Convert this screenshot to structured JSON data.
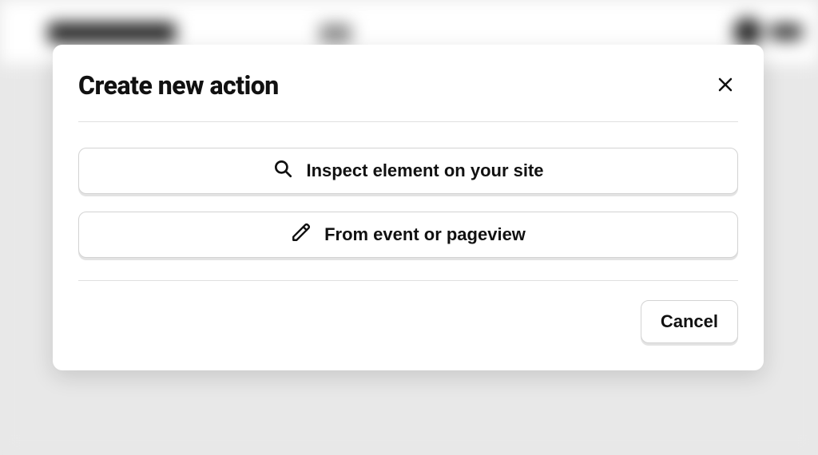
{
  "modal": {
    "title": "Create new action",
    "options": {
      "inspect": "Inspect element on your site",
      "event": "From event or pageview"
    },
    "cancel": "Cancel"
  }
}
